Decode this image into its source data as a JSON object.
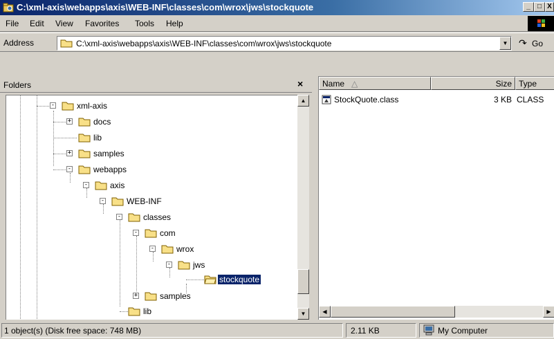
{
  "window": {
    "title": "C:\\xml-axis\\webapps\\axis\\WEB-INF\\classes\\com\\wrox\\jws\\stockquote",
    "minimize_label": "_",
    "maximize_label": "□",
    "close_label": "X"
  },
  "menu": {
    "items": [
      "File",
      "Edit",
      "View",
      "Favorites",
      "Tools",
      "Help"
    ]
  },
  "address": {
    "label": "Address",
    "value": "C:\\xml-axis\\webapps\\axis\\WEB-INF\\classes\\com\\wrox\\jws\\stockquote",
    "go_label": "Go"
  },
  "folders": {
    "title": "Folders",
    "close_label": "×",
    "tree": [
      {
        "label": "xml-axis",
        "expander": "-"
      },
      {
        "label": "docs",
        "expander": "+"
      },
      {
        "label": "lib",
        "expander": ""
      },
      {
        "label": "samples",
        "expander": "+"
      },
      {
        "label": "webapps",
        "expander": "-"
      },
      {
        "label": "axis",
        "expander": "-"
      },
      {
        "label": "WEB-INF",
        "expander": "-"
      },
      {
        "label": "classes",
        "expander": "-"
      },
      {
        "label": "com",
        "expander": "-"
      },
      {
        "label": "wrox",
        "expander": "-"
      },
      {
        "label": "jws",
        "expander": "-"
      },
      {
        "label": "stockquote",
        "expander": "",
        "selected": true
      },
      {
        "label": "samples",
        "expander": "+"
      },
      {
        "label": "lib",
        "expander": ""
      }
    ]
  },
  "list": {
    "columns": {
      "name": "Name",
      "size": "Size",
      "type": "Type"
    },
    "sort_indicator": "△",
    "files": [
      {
        "name": "StockQuote.class",
        "size": "3 KB",
        "type": "CLASS"
      }
    ]
  },
  "status": {
    "objects": "1 object(s) (Disk free space: 748 MB)",
    "size": "2.11 KB",
    "zone": "My Computer"
  },
  "colors": {
    "title_active": "#0a246a",
    "selection": "#0a246a",
    "face": "#d4d0c8"
  },
  "icons": {
    "folder": "folder-icon",
    "open_folder": "open-folder-icon",
    "class_file": "class-file-icon",
    "computer": "computer-icon",
    "go": "go-arrow-icon"
  }
}
